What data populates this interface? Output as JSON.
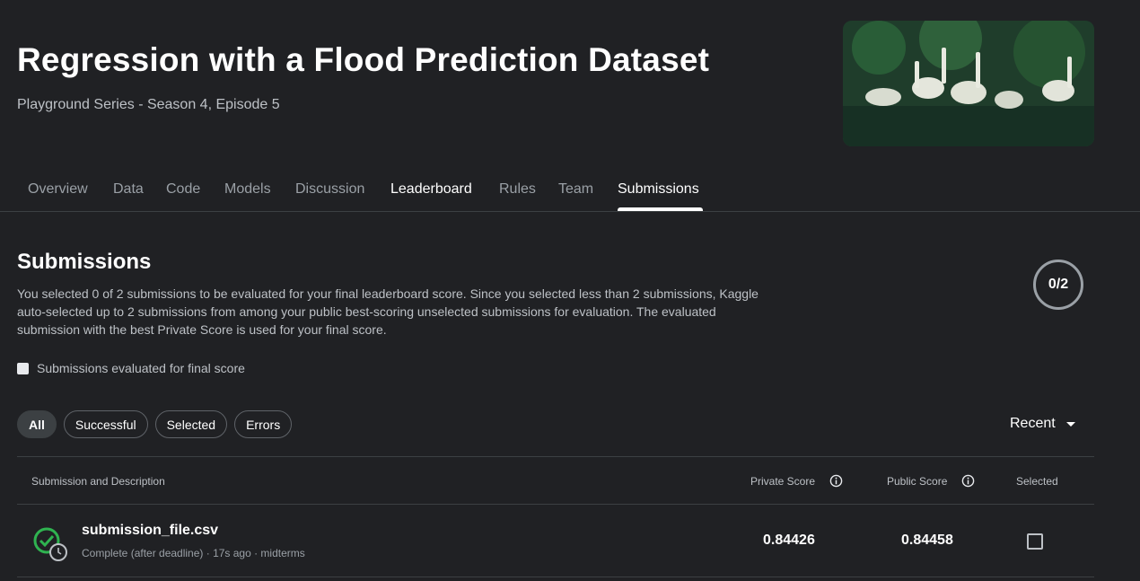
{
  "header": {
    "title": "Regression with a Flood Prediction Dataset",
    "subtitle": "Playground Series - Season 4, Episode 5"
  },
  "tabs": [
    {
      "label": "Overview"
    },
    {
      "label": "Data"
    },
    {
      "label": "Code"
    },
    {
      "label": "Models"
    },
    {
      "label": "Discussion"
    },
    {
      "label": "Leaderboard"
    },
    {
      "label": "Rules"
    },
    {
      "label": "Team"
    },
    {
      "label": "Submissions"
    }
  ],
  "submissions": {
    "title": "Submissions",
    "description": "You selected 0 of 2 submissions to be evaluated for your final leaderboard score. Since you selected less than 2 submissions, Kaggle auto-selected up to 2 submissions from among your public best-scoring unselected submissions for evaluation. The evaluated submission with the best Private Score is used for your final score.",
    "counter": "0/2",
    "final_score_checkbox_label": "Submissions evaluated for final score",
    "filters": [
      "All",
      "Successful",
      "Selected",
      "Errors"
    ],
    "sort_label": "Recent"
  },
  "table": {
    "columns": {
      "submission": "Submission and Description",
      "private": "Private Score",
      "public": "Public Score",
      "selected": "Selected"
    },
    "rows": [
      {
        "file": "submission_file.csv",
        "meta": "Complete (after deadline) · 17s ago · midterms",
        "private_score": "0.84426",
        "public_score": "0.84458"
      }
    ]
  },
  "colors": {
    "background": "#202124",
    "success": "#1e8e3e"
  }
}
